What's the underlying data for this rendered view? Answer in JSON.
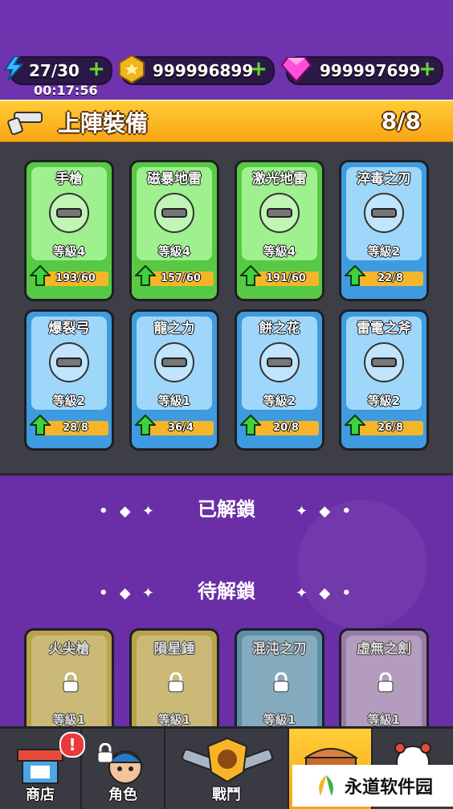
{
  "resources": {
    "energy": "27/30",
    "timer": "00:17:56",
    "coins": "999996899",
    "gems": "999997699",
    "plus": "+"
  },
  "header": {
    "title": "上陣裝備",
    "count": "8/8"
  },
  "equipped": [
    {
      "name": "手槍",
      "level": "等級4",
      "progress": "193/60",
      "rarity": "green"
    },
    {
      "name": "磁暴地雷",
      "level": "等級4",
      "progress": "157/60",
      "rarity": "green"
    },
    {
      "name": "激光地雷",
      "level": "等級4",
      "progress": "191/60",
      "rarity": "green"
    },
    {
      "name": "淬毒之刃",
      "level": "等級2",
      "progress": "22/8",
      "rarity": "blue"
    },
    {
      "name": "爆裂弓",
      "level": "等級2",
      "progress": "28/8",
      "rarity": "blue"
    },
    {
      "name": "龍之力",
      "level": "等級1",
      "progress": "36/4",
      "rarity": "blue"
    },
    {
      "name": "餅之花",
      "level": "等級2",
      "progress": "20/8",
      "rarity": "blue"
    },
    {
      "name": "雷電之斧",
      "level": "等級2",
      "progress": "26/8",
      "rarity": "blue"
    }
  ],
  "sections": {
    "unlocked": "已解鎖",
    "locked": "待解鎖"
  },
  "locked": [
    {
      "name": "火尖槍",
      "level": "等級1",
      "color": "#b8a24a"
    },
    {
      "name": "隕星錘",
      "level": "等級1",
      "color": "#b8a24a"
    },
    {
      "name": "混沌之刃",
      "level": "等級1",
      "color": "#5d8fa8"
    },
    {
      "name": "虛無之劍",
      "level": "等級1",
      "color": "#9a7ba8"
    }
  ],
  "nav": {
    "shop": "商店",
    "character": "角色",
    "battle": "戰鬥",
    "badge": "!"
  },
  "watermark": "永道软件园",
  "colors": {
    "header": "#f8a515",
    "green_card": "#58c944",
    "blue_card": "#3f9bdf",
    "background": "#6a2fa8"
  }
}
